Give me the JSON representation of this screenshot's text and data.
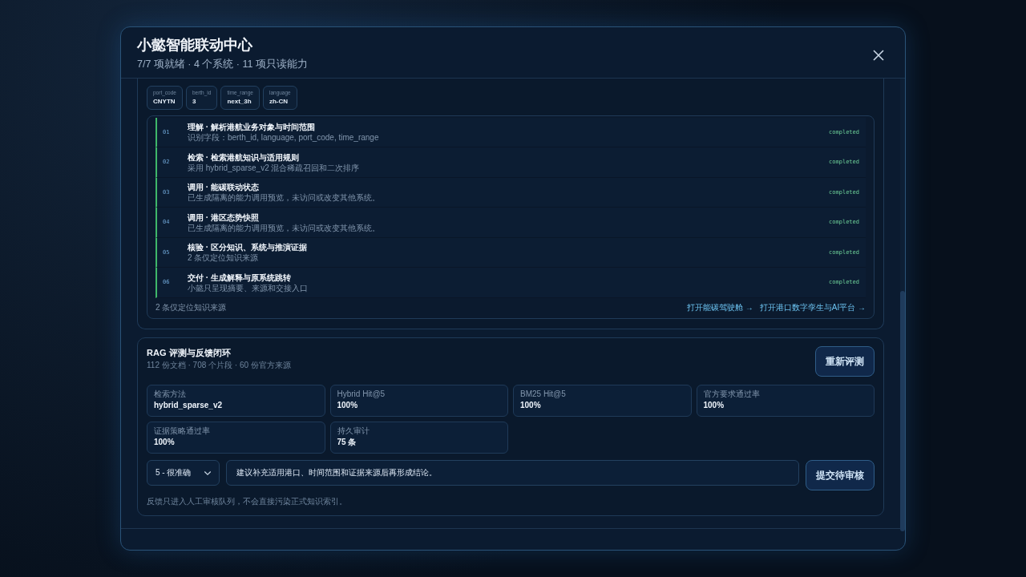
{
  "modal": {
    "title": "小懿智能联动中心",
    "subtitle": "7/7 项就绪 · 4 个系统 · 11 项只读能力"
  },
  "plan": {
    "params": [
      {
        "label": "port_code",
        "value": "CNYTN"
      },
      {
        "label": "berth_id",
        "value": "3"
      },
      {
        "label": "time_range",
        "value": "next_3h"
      },
      {
        "label": "language",
        "value": "zh-CN"
      }
    ],
    "steps": [
      {
        "index": "01",
        "title": "理解 · 解析港航业务对象与时间范围",
        "detail": "识别字段：berth_id, language, port_code, time_range",
        "status": "completed"
      },
      {
        "index": "02",
        "title": "检索 · 检索港航知识与适用规则",
        "detail": "采用 hybrid_sparse_v2 混合稀疏召回和二次排序",
        "status": "completed"
      },
      {
        "index": "03",
        "title": "调用 · 能碳联动状态",
        "detail": "已生成隔离的能力调用预览，未访问或改变其他系统。",
        "status": "completed"
      },
      {
        "index": "04",
        "title": "调用 · 港区态势快照",
        "detail": "已生成隔离的能力调用预览，未访问或改变其他系统。",
        "status": "completed"
      },
      {
        "index": "05",
        "title": "核验 · 区分知识、系统与推演证据",
        "detail": "2 条仅定位知识来源",
        "status": "completed"
      },
      {
        "index": "06",
        "title": "交付 · 生成解释与原系统跳转",
        "detail": "小懿只呈现摘要、来源和交接入口",
        "status": "completed"
      }
    ],
    "footnote": "2 条仅定位知识来源",
    "links": [
      "打开能碳驾驶舱 →",
      "打开港口数字孪生与AI平台 →"
    ]
  },
  "rag": {
    "title": "RAG 评测与反馈闭环",
    "meta": "112 份文档 · 708 个片段 · 60 份官方来源",
    "rerun_button": "重新评测",
    "metrics": [
      {
        "label": "检索方法",
        "value": "hybrid_sparse_v2"
      },
      {
        "label": "Hybrid Hit@5",
        "value": "100%"
      },
      {
        "label": "BM25 Hit@5",
        "value": "100%"
      },
      {
        "label": "官方要求通过率",
        "value": "100%"
      },
      {
        "label": "证据策略通过率",
        "value": "100%"
      },
      {
        "label": "持久审计",
        "value": "75 条"
      }
    ],
    "rating": "5 - 很准确",
    "feedback": "建议补充适用港口、时间范围和证据来源后再形成结论。",
    "submit_button": "提交待审核",
    "note": "反馈只进入人工审核队列，不会直接污染正式知识索引。"
  }
}
